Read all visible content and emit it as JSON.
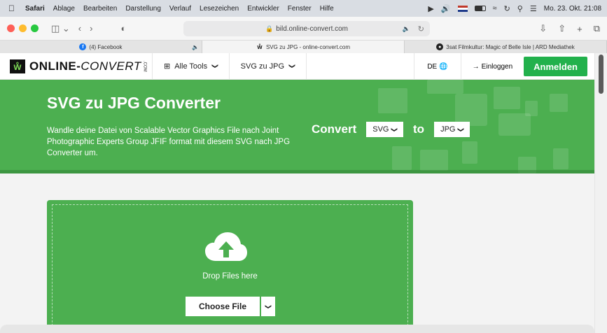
{
  "menubar": {
    "app": "Safari",
    "items": [
      "Ablage",
      "Bearbeiten",
      "Darstellung",
      "Verlauf",
      "Lesezeichen",
      "Entwickler",
      "Fenster",
      "Hilfe"
    ],
    "datetime": "Mo. 23. Okt.  21:08"
  },
  "toolbar": {
    "url": "bild.online-convert.com"
  },
  "tabs": [
    {
      "label": "(4) Facebook",
      "icon": "facebook-icon"
    },
    {
      "label": "SVG zu JPG - online-convert.com",
      "icon": "online-convert-icon"
    },
    {
      "label": "3sat Filmkultur: Magic of Belle Isle | ARD Mediathek",
      "icon": "3sat-icon"
    }
  ],
  "sitenav": {
    "logo_text_a": "ONLINE-",
    "logo_text_b": "CONVERT",
    "logo_com": ".COM",
    "all_tools": "Alle Tools",
    "svg_to_jpg": "SVG zu JPG",
    "language": "DE",
    "login": "Einloggen",
    "signup": "Anmelden"
  },
  "hero": {
    "title": "SVG zu JPG Converter",
    "description": "Wandle deine Datei von Scalable Vector Graphics File nach Joint Photographic Experts Group JFIF format mit diesem SVG nach JPG Converter um.",
    "convert_label": "Convert",
    "from_format": "SVG",
    "to_label": "to",
    "to_format": "JPG"
  },
  "upload": {
    "drop_text": "Drop Files here",
    "choose_file": "Choose File"
  },
  "colors": {
    "brand_green": "#4caf50",
    "signup_green": "#22b14c"
  }
}
